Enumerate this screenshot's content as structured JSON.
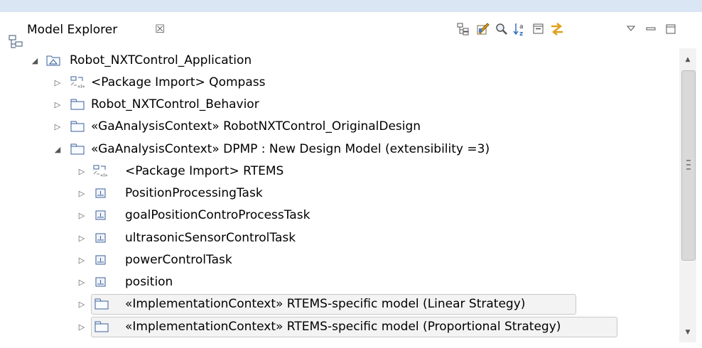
{
  "view": {
    "title": "Model Explorer",
    "close_glyph": "☒",
    "icon": "model-explorer-icon",
    "toolbar": [
      {
        "name": "link-with-editor-icon",
        "tooltip": ""
      },
      {
        "name": "customize-icon",
        "tooltip": ""
      },
      {
        "name": "search-icon",
        "tooltip": ""
      },
      {
        "name": "sort-alphabetically-icon",
        "tooltip": ""
      },
      {
        "name": "collapse-all-icon",
        "tooltip": ""
      },
      {
        "name": "link-sync-icon",
        "tooltip": ""
      },
      {
        "name": "view-menu-icon",
        "tooltip": ""
      },
      {
        "name": "minimize-icon",
        "tooltip": ""
      },
      {
        "name": "maximize-icon",
        "tooltip": ""
      }
    ]
  },
  "tree": {
    "rows": [
      {
        "label": "Robot_NXTControl_Application",
        "expanded": true,
        "icon": "model-icon"
      },
      {
        "label": "<Package Import> Qompass",
        "expanded": false,
        "icon": "package-import-icon"
      },
      {
        "label": "Robot_NXTControl_Behavior",
        "expanded": false,
        "icon": "package-icon"
      },
      {
        "label": "«GaAnalysisContext» RobotNXTControl_OriginalDesign",
        "expanded": false,
        "icon": "package-icon"
      },
      {
        "label": "«GaAnalysisContext» DPMP : New Design Model (extensibility =3)",
        "expanded": true,
        "icon": "package-icon"
      },
      {
        "label": "<Package Import> RTEMS",
        "expanded": false,
        "icon": "package-import-icon"
      },
      {
        "label": "PositionProcessingTask",
        "expanded": false,
        "icon": "instance-icon"
      },
      {
        "label": "goalPositionControProcessTask",
        "expanded": false,
        "icon": "instance-icon"
      },
      {
        "label": "ultrasonicSensorControlTask",
        "expanded": false,
        "icon": "instance-icon"
      },
      {
        "label": "powerControlTask",
        "expanded": false,
        "icon": "instance-icon"
      },
      {
        "label": "position",
        "expanded": false,
        "icon": "instance-icon"
      },
      {
        "label": "«ImplementationContext» RTEMS-specific model (Linear Strategy)",
        "expanded": false,
        "icon": "package-icon"
      },
      {
        "label": "«ImplementationContext» RTEMS-specific model (Proportional Strategy)",
        "expanded": false,
        "icon": "package-icon"
      }
    ]
  },
  "scrollbar": {
    "position": 0.0,
    "visible_fraction": 0.66
  }
}
